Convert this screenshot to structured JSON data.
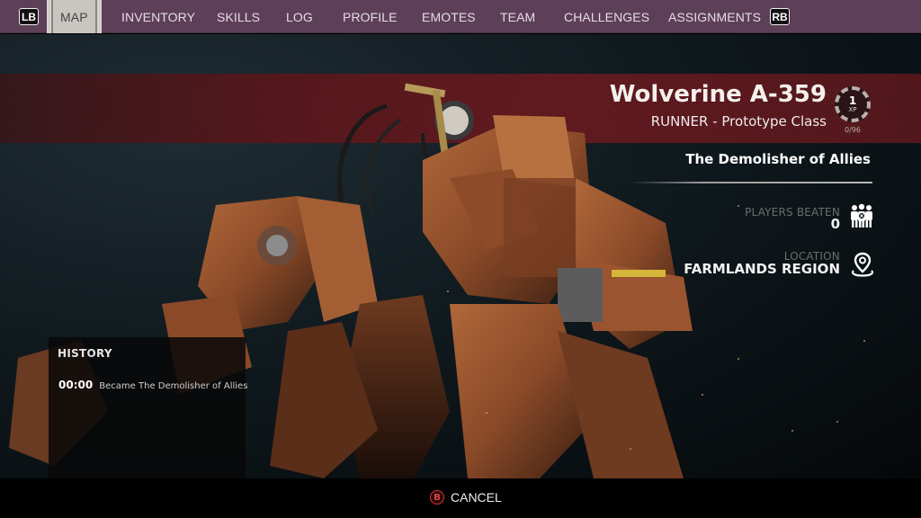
{
  "nav": {
    "left_bumper": "LB",
    "right_bumper": "RB",
    "active_tab": "MAP",
    "tabs": [
      {
        "label": "MAP"
      },
      {
        "label": "INVENTORY"
      },
      {
        "label": "SKILLS"
      },
      {
        "label": "LOG"
      },
      {
        "label": "PROFILE"
      },
      {
        "label": "EMOTES"
      },
      {
        "label": "TEAM"
      },
      {
        "label": "CHALLENGES"
      },
      {
        "label": "ASSIGNMENTS"
      }
    ]
  },
  "character": {
    "name": "Wolverine A-359",
    "class_line": "RUNNER - Prototype Class",
    "title": "The Demolisher of Allies",
    "xp": {
      "level": "1",
      "unit": "XP",
      "progress": "0/96",
      "progress_fraction": 0.0
    }
  },
  "stats": {
    "players_beaten": {
      "label": "PLAYERS BEATEN",
      "value": "0",
      "icon": "players-beaten-icon"
    },
    "location": {
      "label": "LOCATION",
      "value": "FARMLANDS REGION",
      "icon": "location-pin-icon"
    }
  },
  "history": {
    "title": "HISTORY",
    "entries": [
      {
        "time": "00:00",
        "text": "Became The Demolisher of Allies"
      }
    ]
  },
  "footer": {
    "cancel_button_glyph": "B",
    "cancel_label": "CANCEL",
    "accent_color": "#d8363a"
  },
  "colors": {
    "nav_bg": "#5e3f58",
    "band_red": "#6a1d22"
  }
}
